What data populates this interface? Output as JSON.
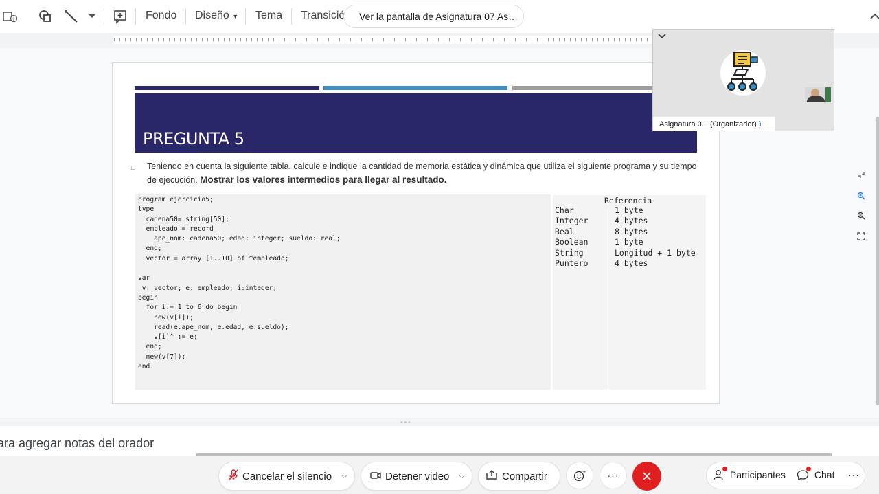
{
  "toolbar": {
    "items": [
      "Fondo",
      "Diseño",
      "Tema",
      "Transición"
    ],
    "share_notice": "Ver la pantalla de Asignatura 07 As…"
  },
  "slide": {
    "title": "PREGUNTA 5",
    "question_text": "Teniendo en cuenta la siguiente tabla, calcule e indique la cantidad de memoria estática y dinámica que utiliza el siguiente programa y su tiempo de ejecución.",
    "question_bold": "Mostrar los valores intermedios para llegar al resultado.",
    "bar_colors": [
      "#2a2768",
      "#3b8fc4",
      "#9e9e9e"
    ],
    "code": "program ejercicio5;\ntype\n  cadena50= string[50];\n  empleado = record\n    ape_nom: cadena50; edad: integer; sueldo: real;\n  end;\n  vector = array [1..10] of ^empleado;\n\nvar\n v: vector; e: empleado; i:integer;\nbegin\n  for i:= 1 to 6 do begin\n    new(v[i]);\n    read(e.ape_nom, e.edad, e.sueldo);\n    v[i]^ := e;\n  end;\n  new(v[7]);\nend.",
    "reference": {
      "title": "Referencia",
      "rows": [
        {
          "type": "Char",
          "size": "1 byte"
        },
        {
          "type": "Integer",
          "size": "4 bytes"
        },
        {
          "type": "Real",
          "size": "8 bytes"
        },
        {
          "type": "Boolean",
          "size": "1 byte"
        },
        {
          "type": "String",
          "size": "Longitud + 1 byte"
        },
        {
          "type": "Puntero",
          "size": "4 bytes"
        }
      ]
    }
  },
  "video": {
    "label": "Asignatura 0... (Organizador)"
  },
  "notes": {
    "placeholder": "ara agregar notas del orador"
  },
  "meeting": {
    "unmute_label": "Cancelar el silencio",
    "video_label": "Detener video",
    "share_label": "Compartir",
    "participants_label": "Participantes",
    "chat_label": "Chat",
    "more_label": "···"
  },
  "colors": {
    "title_bg": "#2a2768",
    "end_call": "#e02020",
    "notification": "#e02020"
  }
}
